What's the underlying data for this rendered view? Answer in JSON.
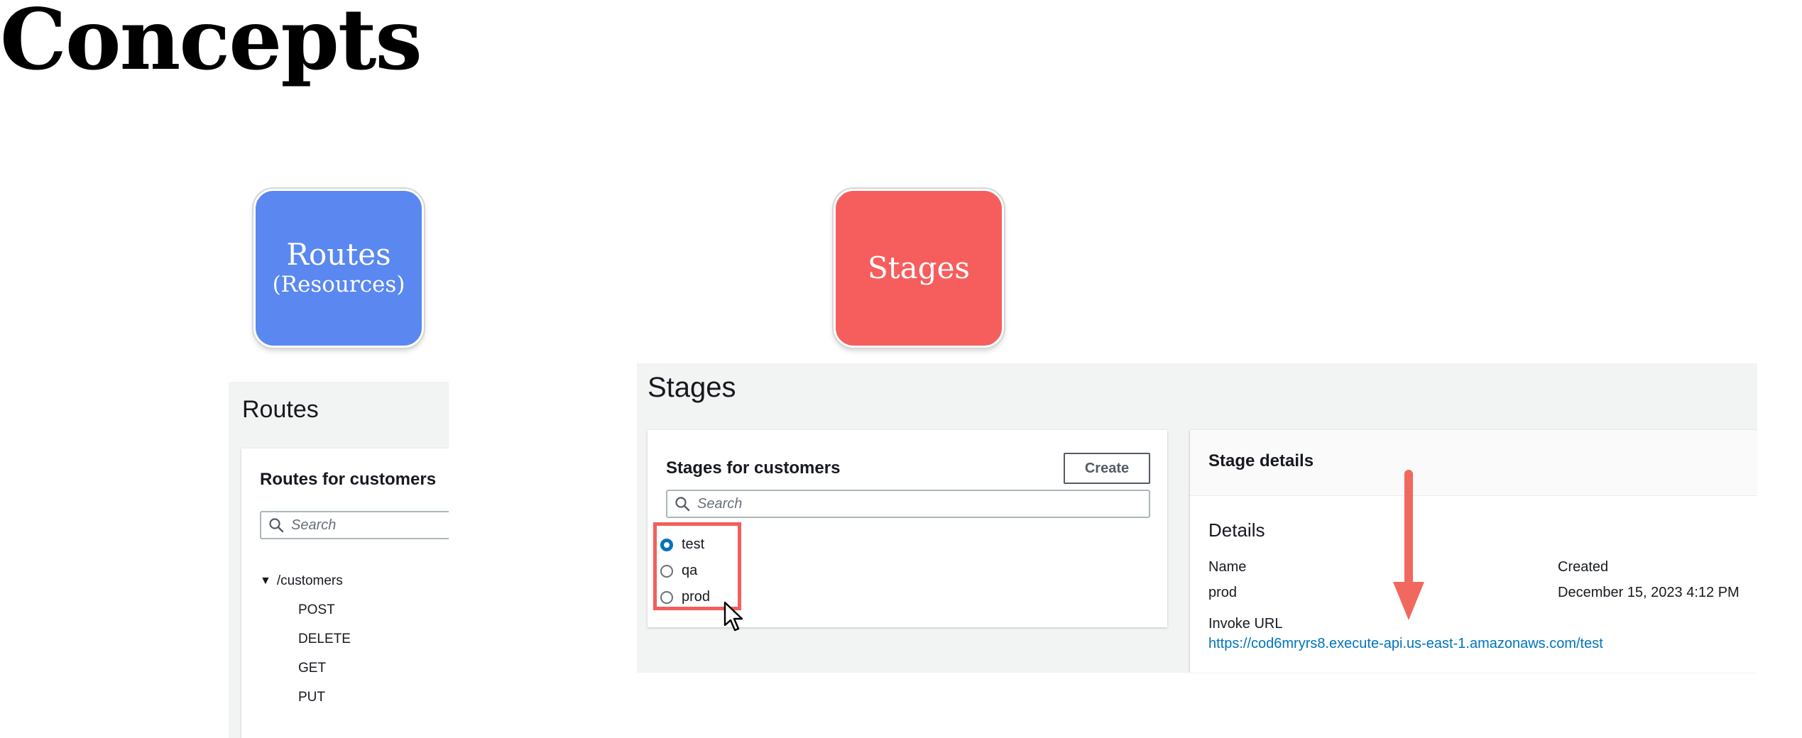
{
  "page": {
    "title": "Concepts"
  },
  "tiles": {
    "routes": {
      "label": "Routes",
      "sublabel": "(Resources)",
      "color": "#5a88f0"
    },
    "stages": {
      "label": "Stages",
      "color": "#f65e5d"
    }
  },
  "routes_panel": {
    "heading": "Routes",
    "card_title": "Routes for customers",
    "search_placeholder": "Search",
    "tree": {
      "root": "/customers",
      "methods": [
        "POST",
        "DELETE",
        "GET",
        "PUT"
      ]
    }
  },
  "stages_panel": {
    "heading": "Stages",
    "card_title": "Stages for customers",
    "create_label": "Create",
    "search_placeholder": "Search",
    "stages": [
      {
        "name": "test",
        "selected": true
      },
      {
        "name": "qa",
        "selected": false
      },
      {
        "name": "prod",
        "selected": false
      }
    ],
    "highlight_color": "#f1605a"
  },
  "stage_details": {
    "title": "Stage details",
    "section": "Details",
    "name_label": "Name",
    "name_value": "prod",
    "created_label": "Created",
    "created_value": "December 15, 2023 4:12 PM",
    "invoke_label": "Invoke URL",
    "invoke_url": "https://cod6mryrs8.execute-api.us-east-1.amazonaws.com/test",
    "link_color": "#0073bb"
  },
  "icons": [
    "search-icon",
    "caret-down-icon",
    "mouse-pointer-icon",
    "down-arrow-icon"
  ]
}
